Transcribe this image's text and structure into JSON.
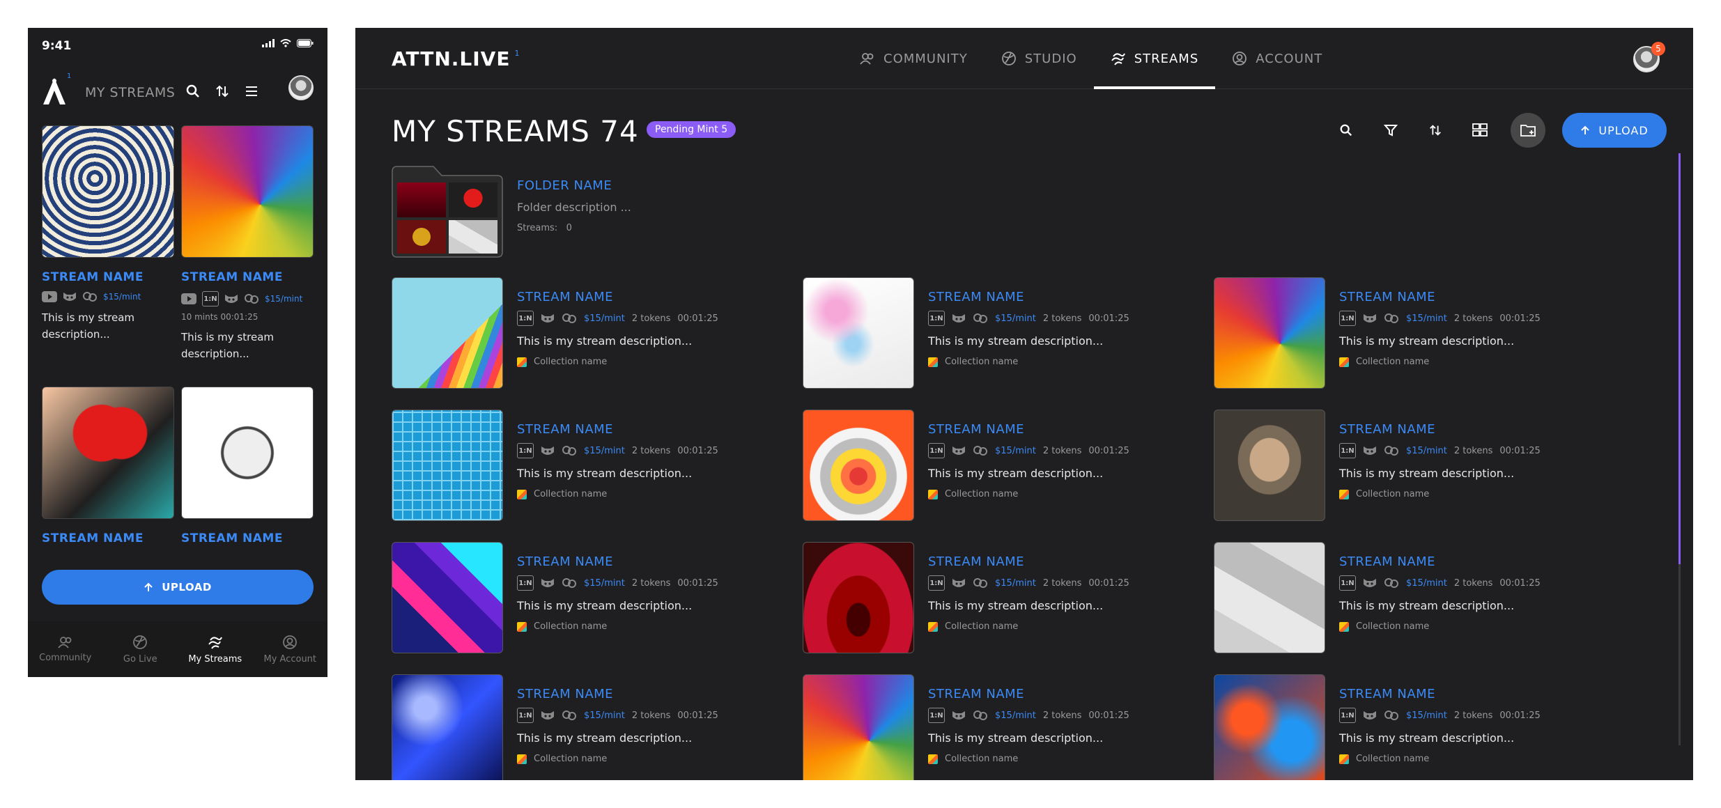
{
  "mobile": {
    "status_time": "9:41",
    "header_title": "MY STREAMS",
    "logo_superscript": "1",
    "cards": [
      {
        "name": "STREAM NAME",
        "price": "$15/mint",
        "meta": "",
        "desc": "This is my stream description...",
        "art": "art-floral",
        "icon_type": "youtube"
      },
      {
        "name": "STREAM NAME",
        "price": "$15/mint",
        "meta": "10 mints   00:01:25",
        "desc": "This is my stream description...",
        "art": "art-swirl",
        "icon_type": "youtube"
      },
      {
        "name": "STREAM NAME",
        "price": "",
        "meta": "",
        "desc": "",
        "art": "art-heart",
        "icon_type": ""
      },
      {
        "name": "STREAM NAME",
        "price": "",
        "meta": "",
        "desc": "",
        "art": "art-bulb",
        "icon_type": ""
      }
    ],
    "upload_label": "UPLOAD",
    "nav": [
      {
        "label": "Community",
        "icon": "community-icon",
        "active": false
      },
      {
        "label": "Go Live",
        "icon": "globe-icon",
        "active": false
      },
      {
        "label": "My Streams",
        "icon": "streams-icon",
        "active": true
      },
      {
        "label": "My Account",
        "icon": "account-icon",
        "active": false
      }
    ]
  },
  "desktop": {
    "logo": "ATTN.LIVE",
    "logo_superscript": "1",
    "nav": [
      {
        "label": "COMMUNITY",
        "icon": "community-icon",
        "active": false
      },
      {
        "label": "STUDIO",
        "icon": "globe-icon",
        "active": false
      },
      {
        "label": "STREAMS",
        "icon": "streams-icon",
        "active": true
      },
      {
        "label": "ACCOUNT",
        "icon": "account-icon",
        "active": false
      }
    ],
    "notification_count": "5",
    "page_title": "MY STREAMS 74",
    "pending_badge": "Pending Mint 5",
    "upload_label": "UPLOAD",
    "folder": {
      "name": "FOLDER NAME",
      "description": "Folder description ...",
      "streams_label": "Streams:",
      "streams_count": "0"
    },
    "stream_common": {
      "badge": "1:N",
      "price": "$15/mint",
      "tokens": "2 tokens",
      "duration": "00:01:25",
      "description": "This is my stream description...",
      "collection": "Collection name"
    },
    "streams": [
      {
        "name": "STREAM NAME",
        "art": "art-pencils"
      },
      {
        "name": "STREAM NAME",
        "art": "art-marble"
      },
      {
        "name": "STREAM NAME",
        "art": "art-swirl"
      },
      {
        "name": "STREAM NAME",
        "art": "art-tiles"
      },
      {
        "name": "STREAM NAME",
        "art": "art-rings"
      },
      {
        "name": "STREAM NAME",
        "art": "art-mosaic"
      },
      {
        "name": "STREAM NAME",
        "art": "art-geo"
      },
      {
        "name": "STREAM NAME",
        "art": "art-drop"
      },
      {
        "name": "STREAM NAME",
        "art": "art-papers"
      },
      {
        "name": "STREAM NAME",
        "art": "art-wave"
      },
      {
        "name": "STREAM NAME",
        "art": "art-swirl"
      },
      {
        "name": "STREAM NAME",
        "art": "art-smoke"
      }
    ]
  },
  "colors": {
    "accent": "#3b8af5",
    "upload_button": "#2f7be8",
    "pending_badge": "#8b5cf6",
    "notification_badge": "#ff5a2c",
    "background": "#1f1f21"
  }
}
